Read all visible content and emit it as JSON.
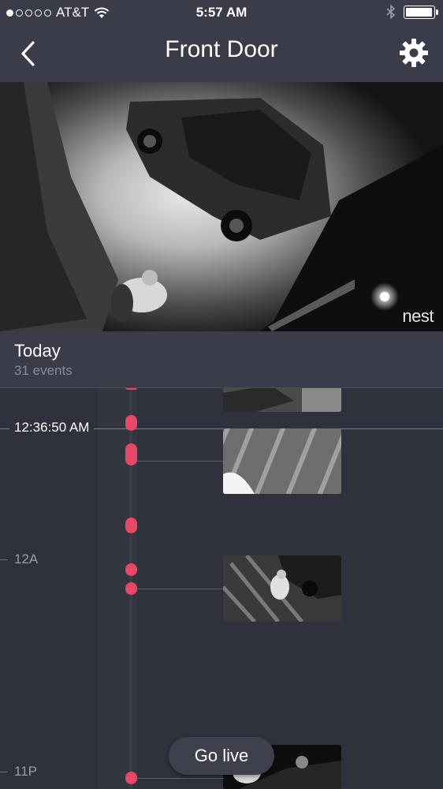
{
  "status_bar": {
    "carrier": "AT&T",
    "time": "5:57 AM",
    "signal_bars_filled": 1,
    "battery_level": 0.9
  },
  "nav": {
    "title": "Front Door",
    "back_icon": "chevron-left-icon",
    "settings_icon": "gear-icon"
  },
  "video": {
    "watermark": "nest"
  },
  "day": {
    "title": "Today",
    "event_count": "31 events"
  },
  "timeline": {
    "current_time": "12:36:50 AM",
    "ticks": [
      "12A",
      "11P"
    ],
    "event_color": "#e84865"
  },
  "go_live_label": "Go live"
}
